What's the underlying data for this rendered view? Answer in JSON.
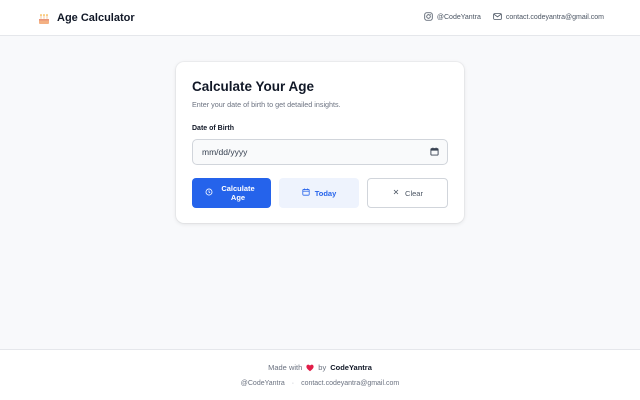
{
  "header": {
    "title": "Age Calculator",
    "brand_icon": "cake-icon",
    "instagram_label": "@CodeYantra",
    "email_label": "contact.codeyantra@gmail.com"
  },
  "card": {
    "title": "Calculate Your Age",
    "subtitle": "Enter your date of birth to get detailed insights.",
    "dob_label": "Date of Birth",
    "dob_placeholder": "mm/dd/yyyy",
    "buttons": {
      "calculate": "Calculate Age",
      "today": "Today",
      "clear": "Clear"
    }
  },
  "footer": {
    "made_with": "Made with",
    "by": "by",
    "brand": "CodeYantra",
    "instagram": "@CodeYantra",
    "separator": "·",
    "email": "contact.codeyantra@gmail.com"
  },
  "colors": {
    "primary": "#2563eb",
    "today_bg": "#eef3fd",
    "heart": "#e11d48"
  }
}
